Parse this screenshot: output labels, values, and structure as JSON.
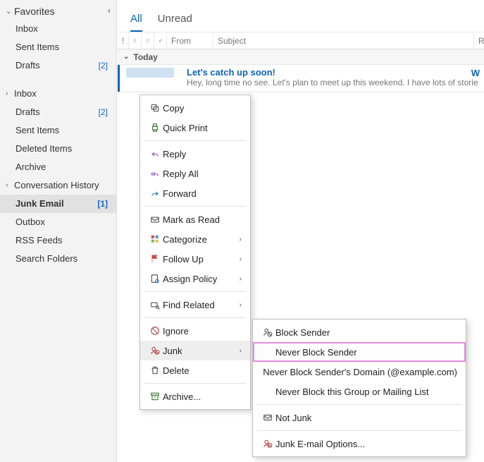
{
  "sidebar": {
    "favorites_label": "Favorites",
    "favorites": [
      {
        "label": "Inbox",
        "count": ""
      },
      {
        "label": "Sent Items",
        "count": ""
      },
      {
        "label": "Drafts",
        "count": "[2]"
      }
    ],
    "folders": [
      {
        "label": "Inbox",
        "expandable": true,
        "count": ""
      },
      {
        "label": "Drafts",
        "count": "[2]"
      },
      {
        "label": "Sent Items",
        "count": ""
      },
      {
        "label": "Deleted Items",
        "count": ""
      },
      {
        "label": "Archive",
        "count": ""
      },
      {
        "label": "Conversation History",
        "expandable": true,
        "count": ""
      },
      {
        "label": "Junk Email",
        "count": "[1]",
        "selected": true
      },
      {
        "label": "Outbox",
        "count": ""
      },
      {
        "label": "RSS Feeds",
        "count": ""
      },
      {
        "label": "Search Folders",
        "count": ""
      }
    ]
  },
  "tabs": {
    "all": "All",
    "unread": "Unread"
  },
  "columns": {
    "importance": "!",
    "reminder_icon": "reminder",
    "flag_icon": "flag",
    "attachment_icon": "attachment",
    "from": "From",
    "subject": "Subject",
    "received": "R"
  },
  "group_today": "Today",
  "message": {
    "subject": "Let's catch up soon!",
    "preview": "Hey, long time no see. Let's plan to meet up this weekend. I have lots of stories to",
    "received_trunc": "W"
  },
  "ctx_main": {
    "copy": "Copy",
    "quick_print": "Quick Print",
    "reply": "Reply",
    "reply_all": "Reply All",
    "forward": "Forward",
    "mark_read": "Mark as Read",
    "categorize": "Categorize",
    "follow_up": "Follow Up",
    "assign_policy": "Assign Policy",
    "find_related": "Find Related",
    "ignore": "Ignore",
    "junk": "Junk",
    "delete": "Delete",
    "archive": "Archive..."
  },
  "ctx_junk": {
    "block_sender": "Block Sender",
    "never_block_sender": "Never Block Sender",
    "never_block_domain": "Never Block Sender's Domain (@example.com)",
    "never_block_group": "Never Block this Group or Mailing List",
    "not_junk": "Not Junk",
    "options": "Junk E-mail Options..."
  }
}
